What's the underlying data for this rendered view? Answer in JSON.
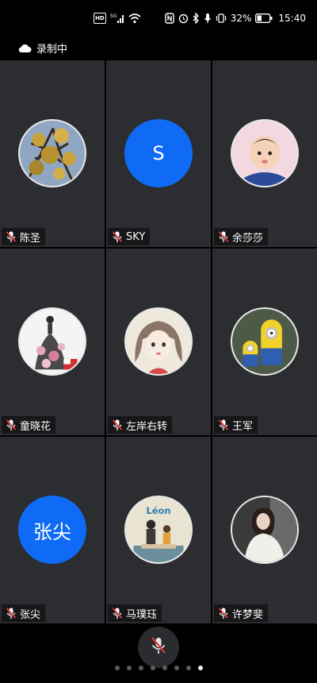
{
  "status_bar": {
    "hd_label": "HD",
    "network_label": "5G",
    "battery_percent": "32%",
    "time": "15:40"
  },
  "recording": {
    "label": "录制中",
    "icon": "cloud-icon"
  },
  "participants": [
    {
      "name": "陈圣",
      "avatar_type": "photo",
      "avatar_desc_icon": "tree-photo-avatar",
      "muted": true
    },
    {
      "name": "SKY",
      "avatar_type": "letter",
      "avatar_letter": "S",
      "muted": true
    },
    {
      "name": "余莎莎",
      "avatar_type": "photo",
      "avatar_desc_icon": "baby-photo-avatar",
      "muted": true
    },
    {
      "name": "童晓花",
      "avatar_type": "photo",
      "avatar_desc_icon": "dress-illustration-avatar",
      "muted": true
    },
    {
      "name": "左岸右转",
      "avatar_type": "photo",
      "avatar_desc_icon": "girl-illustration-avatar",
      "muted": true
    },
    {
      "name": "王军",
      "avatar_type": "photo",
      "avatar_desc_icon": "minion-avatar",
      "muted": true
    },
    {
      "name": "张尖",
      "avatar_type": "letter",
      "avatar_letter": "张尖",
      "muted": true
    },
    {
      "name": "马璞珏",
      "avatar_type": "photo",
      "avatar_desc_icon": "leon-poster-avatar",
      "avatar_text": "Léon",
      "muted": true
    },
    {
      "name": "许梦斐",
      "avatar_type": "photo",
      "avatar_desc_icon": "woman-photo-avatar",
      "muted": true
    }
  ],
  "bottom_bar": {
    "mic_button_icon": "microphone-off-icon",
    "page_count": 8,
    "active_page": 8
  },
  "colors": {
    "tile_bg": "#2b2d30",
    "letter_avatar_bg": "#0f6bf5",
    "mic_off_red": "#e53935"
  }
}
